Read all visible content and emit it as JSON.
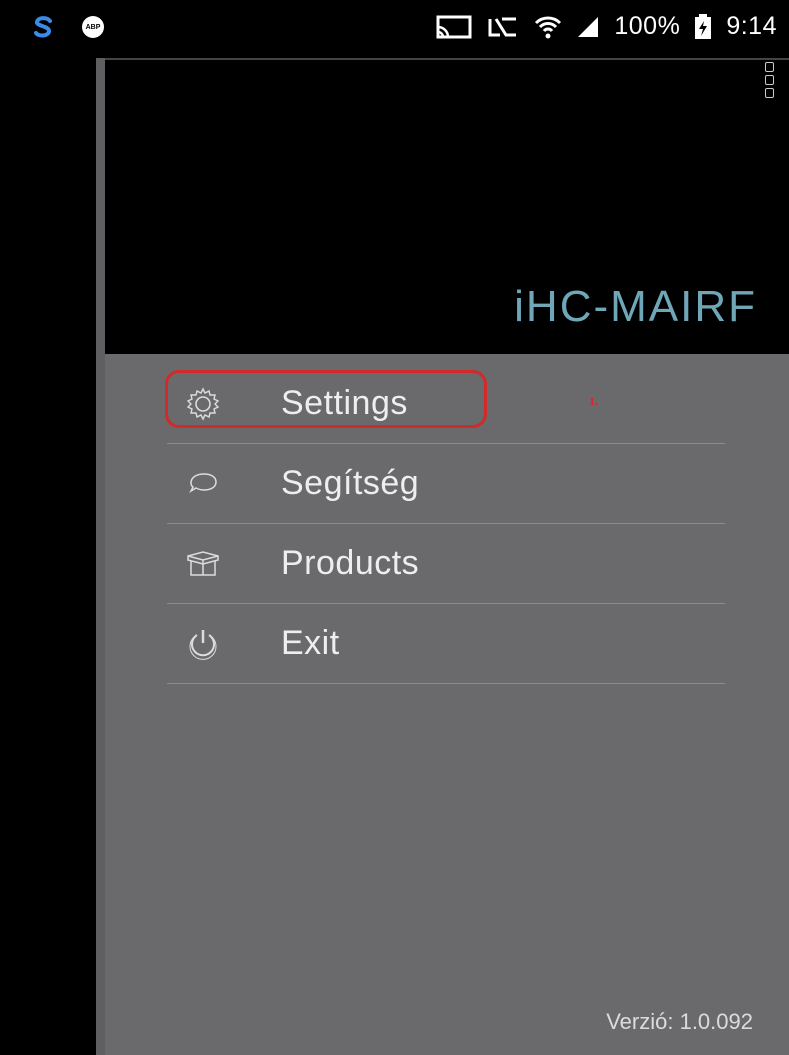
{
  "status_bar": {
    "battery": "100%",
    "time": "9:14",
    "icons": [
      "skype-icon",
      "adblock-icon",
      "cast-icon",
      "nfc-icon",
      "wifi-icon",
      "signal-icon",
      "battery-icon"
    ],
    "adblock_text": "ABP"
  },
  "header": {
    "app_title": "iHC-MAIRF"
  },
  "menu": {
    "items": [
      {
        "label": "Settings",
        "icon": "gear-icon"
      },
      {
        "label": "Segítség",
        "icon": "chat-bubble-icon"
      },
      {
        "label": "Products",
        "icon": "box-icon"
      },
      {
        "label": "Exit",
        "icon": "power-icon"
      }
    ],
    "step_marker": "1."
  },
  "footer": {
    "version": "Verzió: 1.0.092"
  },
  "colors": {
    "panel": "#6a6a6c",
    "header_bg": "#000000",
    "title": "#6fa7b8",
    "highlight": "#d02a2a"
  }
}
